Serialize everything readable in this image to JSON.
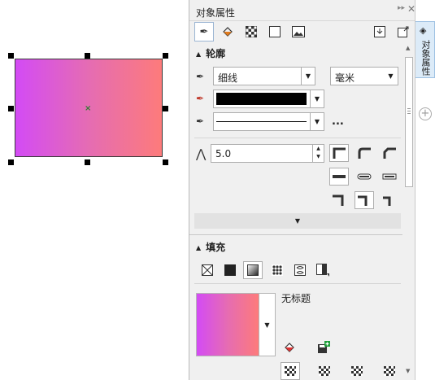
{
  "panel": {
    "title": "对象属性",
    "toolbar": [
      {
        "icon": "pen-nib-icon"
      },
      {
        "icon": "paint-bucket-icon"
      },
      {
        "icon": "transparency-icon"
      },
      {
        "icon": "frame-icon"
      },
      {
        "icon": "picture-icon"
      },
      {
        "icon": "import-icon"
      },
      {
        "icon": "export-icon"
      }
    ]
  },
  "outline": {
    "heading": "轮廓",
    "width_value": "细线",
    "unit_value": "毫米",
    "miter_value": "5.0",
    "more_label": "..."
  },
  "fill": {
    "heading": "填充",
    "name": "无标题",
    "gradient_colors": [
      "#d34bf5",
      "#fd7b7b"
    ]
  },
  "side_tab": {
    "label": "对象属性"
  },
  "accent": "#9bb5d3"
}
